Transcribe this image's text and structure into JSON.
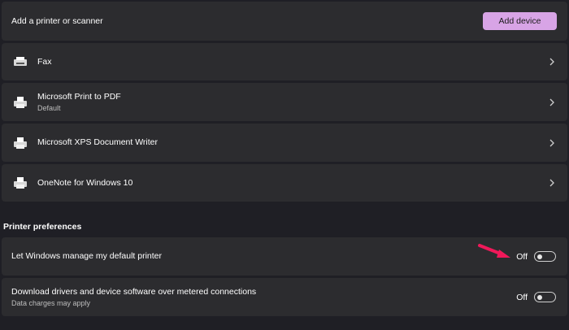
{
  "add_row": {
    "label": "Add a printer or scanner",
    "button_label": "Add device"
  },
  "printers": [
    {
      "name": "Fax",
      "subtitle": ""
    },
    {
      "name": "Microsoft Print to PDF",
      "subtitle": "Default"
    },
    {
      "name": "Microsoft XPS Document Writer",
      "subtitle": ""
    },
    {
      "name": "OneNote for Windows 10",
      "subtitle": ""
    }
  ],
  "preferences": {
    "heading": "Printer preferences",
    "items": [
      {
        "label": "Let Windows manage my default printer",
        "subtitle": "",
        "state": "Off"
      },
      {
        "label": "Download drivers and device software over metered connections",
        "subtitle": "Data charges may apply",
        "state": "Off"
      }
    ]
  },
  "colors": {
    "accent": "#d8a4e6",
    "annotation_arrow": "#f0195a",
    "panel": "#2c2c2f",
    "background": "#1f1f25"
  },
  "icons": {
    "printer": "printer-icon",
    "fax": "fax-icon",
    "chevron": "chevron-right-icon"
  }
}
